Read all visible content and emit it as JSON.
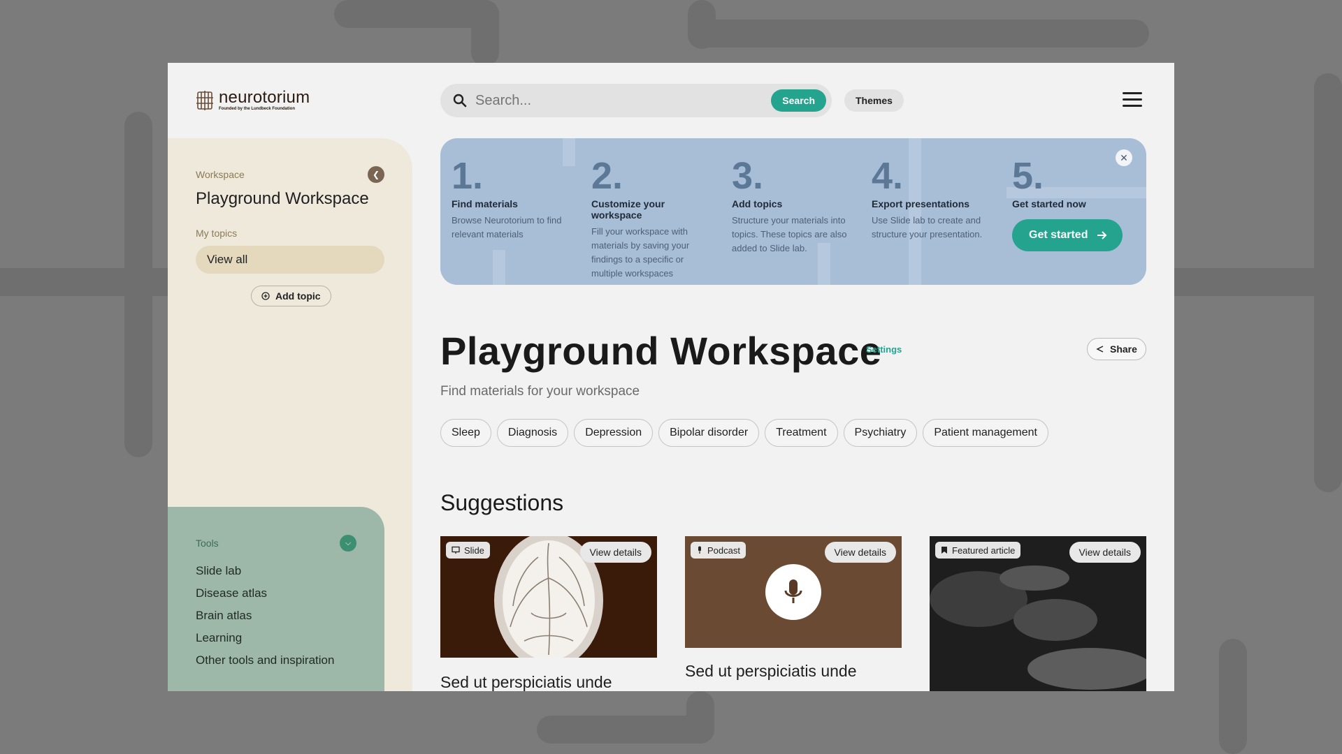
{
  "brand": {
    "name": "neurotorium",
    "tagline": "Founded by the Lundbeck Foundation"
  },
  "header": {
    "search_placeholder": "Search...",
    "search_button": "Search",
    "themes_button": "Themes"
  },
  "sidebar": {
    "workspace_label": "Workspace",
    "workspace_title": "Playground Workspace",
    "topics_label": "My topics",
    "view_all": "View all",
    "add_topic": "Add topic",
    "tools": {
      "label": "Tools",
      "items": [
        "Slide lab",
        "Disease atlas",
        "Brain atlas",
        "Learning",
        "Other tools and inspiration"
      ]
    }
  },
  "onboarding": {
    "steps": [
      {
        "number": "1.",
        "title": "Find materials",
        "desc": "Browse Neurotorium to find relevant materials"
      },
      {
        "number": "2.",
        "title": "Customize your workspace",
        "desc": "Fill your workspace with materials by saving your findings to a specific or multiple workspaces"
      },
      {
        "number": "3.",
        "title": "Add topics",
        "desc": "Structure your materials into topics. These topics are also added to Slide lab."
      },
      {
        "number": "4.",
        "title": "Export presentations",
        "desc": "Use Slide lab to create and structure your presentation."
      },
      {
        "number": "5.",
        "title": "Get started now",
        "desc": ""
      }
    ],
    "cta": "Get started"
  },
  "main": {
    "title": "Playground Workspace",
    "settings": "Settings",
    "share": "Share",
    "subtitle": "Find materials for your workspace",
    "tags": [
      "Sleep",
      "Diagnosis",
      "Depression",
      "Bipolar disorder",
      "Treatment",
      "Psychiatry",
      "Patient management"
    ],
    "suggestions_title": "Suggestions",
    "cards": [
      {
        "badge": "Slide",
        "details": "View details",
        "title": "Sed ut perspiciatis unde",
        "icon": "monitor-icon"
      },
      {
        "badge": "Podcast",
        "details": "View details",
        "title": "Sed ut perspiciatis unde",
        "icon": "microphone-icon"
      },
      {
        "badge": "Featured article",
        "details": "View details",
        "title": "",
        "icon": "bookmark-icon"
      }
    ]
  },
  "colors": {
    "accent": "#24a48f",
    "sidebar": "#efe9dc",
    "tools": "#9db8a9",
    "banner": "#a8bdd6"
  }
}
